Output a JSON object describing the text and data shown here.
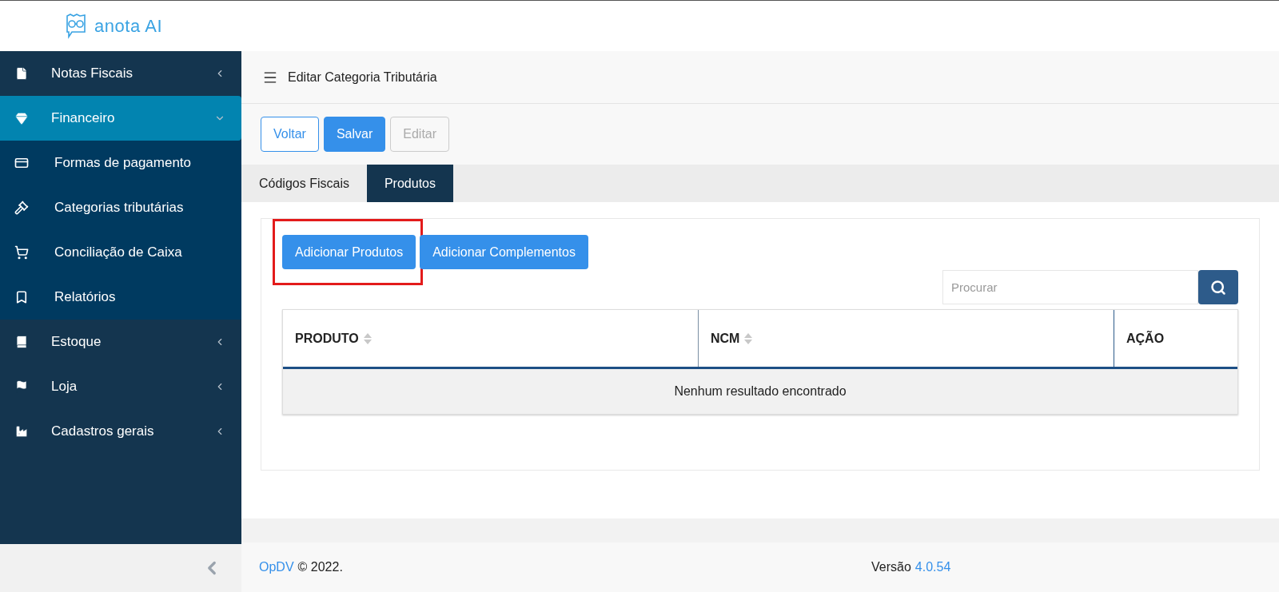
{
  "logo": {
    "text": "anota AI"
  },
  "sidebar": {
    "items": [
      {
        "label": "Notas Fiscais",
        "expanded": false,
        "selected": false
      },
      {
        "label": "Financeiro",
        "expanded": true,
        "selected": true,
        "children": [
          {
            "label": "Formas de pagamento"
          },
          {
            "label": "Categorias tributárias"
          },
          {
            "label": "Conciliação de Caixa"
          },
          {
            "label": "Relatórios"
          }
        ]
      },
      {
        "label": "Estoque",
        "expanded": false,
        "selected": false
      },
      {
        "label": "Loja",
        "expanded": false,
        "selected": false
      },
      {
        "label": "Cadastros gerais",
        "expanded": false,
        "selected": false
      }
    ]
  },
  "page_title": "Editar Categoria Tributária",
  "actions": [
    {
      "label": "Voltar",
      "kind": "outline",
      "disabled": false
    },
    {
      "label": "Salvar",
      "kind": "primary",
      "disabled": false
    },
    {
      "label": "Editar",
      "kind": "outline",
      "disabled": true
    }
  ],
  "tabs": [
    {
      "label": "Códigos Fiscais",
      "selected": false
    },
    {
      "label": "Produtos",
      "selected": true
    }
  ],
  "add_buttons": [
    {
      "label": "Adicionar Produtos",
      "highlighted": true
    },
    {
      "label": "Adicionar Complementos",
      "highlighted": false
    }
  ],
  "search": {
    "placeholder": "Procurar"
  },
  "table": {
    "columns": [
      {
        "label": "PRODUTO",
        "sortable": true
      },
      {
        "label": "NCM",
        "sortable": true
      },
      {
        "label": "AÇÃO",
        "sortable": false
      }
    ],
    "empty_message": "Nenhum resultado encontrado"
  },
  "footer": {
    "brand": "OpDV",
    "copyright": "© 2022.",
    "version_label": "Versão",
    "version": "4.0.54"
  }
}
